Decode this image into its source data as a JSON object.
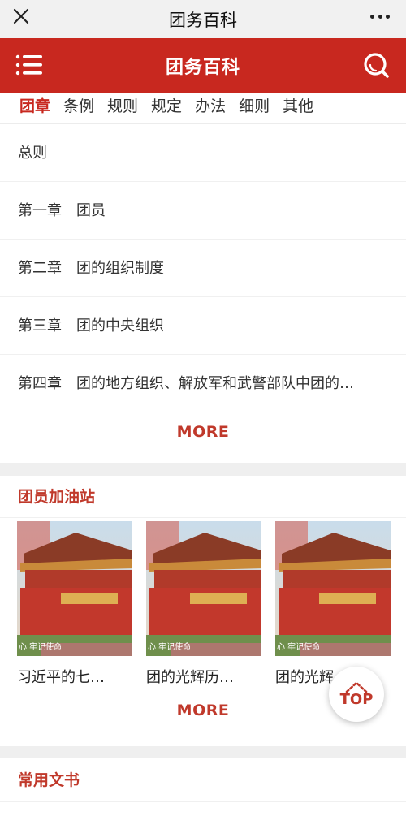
{
  "window": {
    "title": "团务百科",
    "close_icon": "close-icon",
    "more_icon": "more-dots-icon"
  },
  "header": {
    "title": "团务百科",
    "menu_icon": "menu-icon",
    "search_icon": "search-icon",
    "color": "#c8281f"
  },
  "tabs": [
    {
      "label": "团章",
      "active": true
    },
    {
      "label": "条例"
    },
    {
      "label": "规则"
    },
    {
      "label": "规定"
    },
    {
      "label": "办法"
    },
    {
      "label": "细则"
    },
    {
      "label": "其他"
    }
  ],
  "chapters": [
    "总则",
    "第一章　团员",
    "第二章　团的组织制度",
    "第三章　团的中央组织",
    "第四章　团的地方组织、解放军和武警部队中团的…"
  ],
  "more_label": "MORE",
  "station": {
    "title": "团员加油站",
    "items": [
      {
        "caption": "习近平的七…",
        "image_text": "心 牢记使命"
      },
      {
        "caption": "团的光辉历…",
        "image_text": "心 牢记使命"
      },
      {
        "caption": "团的光辉",
        "image_text": "心 牢记使命"
      }
    ]
  },
  "documents": {
    "title": "常用文书"
  },
  "top_button": {
    "label": "TOP",
    "icon": "arrow-up-dashed-icon"
  },
  "accent_color": "#c0392b"
}
